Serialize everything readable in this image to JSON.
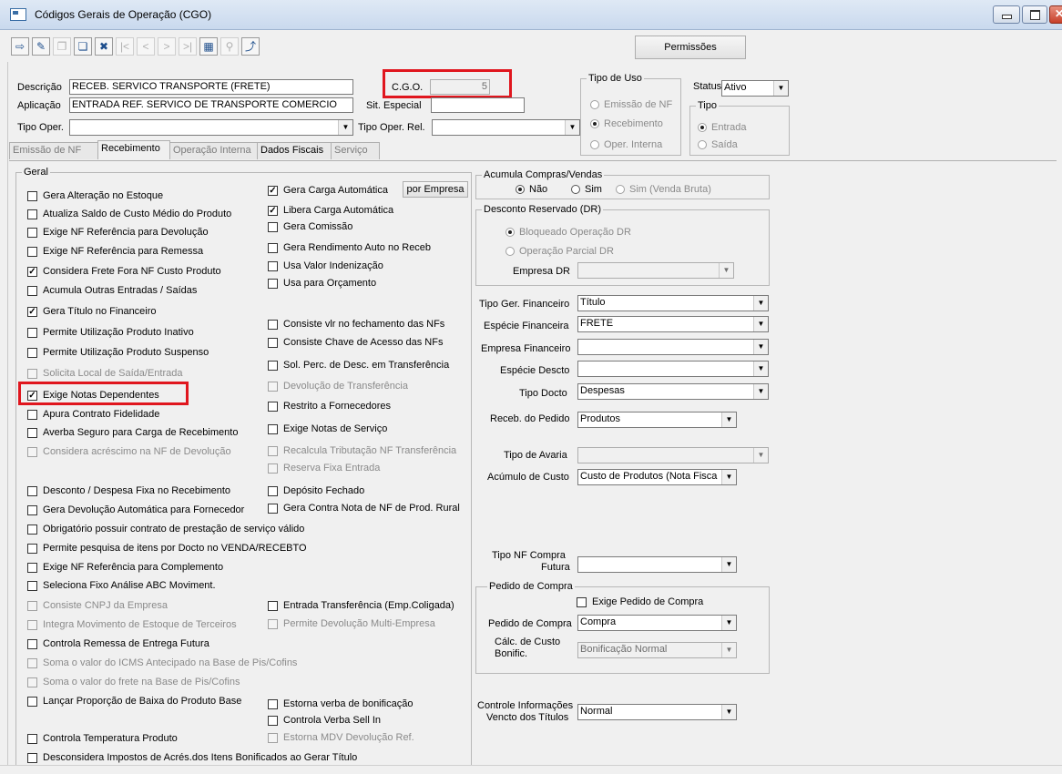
{
  "window": {
    "title": "Códigos Gerais de Operação (CGO)"
  },
  "toolbar": {
    "permissoes_label": "Permissões"
  },
  "header": {
    "descricao_label": "Descrição",
    "descricao_value": "RECEB. SERVICO TRANSPORTE (FRETE)",
    "aplicacao_label": "Aplicação",
    "aplicacao_value": "ENTRADA REF. SERVICO DE TRANSPORTE COMERCIO",
    "cgo_label": "C.G.O.",
    "cgo_value": "5",
    "sit_especial_label": "Sit. Especial",
    "sit_especial_value": "",
    "tipo_oper_label": "Tipo Oper.",
    "tipo_oper_value": "",
    "tipo_oper_rel_label": "Tipo Oper. Rel.",
    "tipo_oper_rel_value": "",
    "tipo_uso_label": "Tipo de Uso",
    "tipo_uso_options": [
      "Emissão de NF",
      "Recebimento",
      "Oper. Interna"
    ],
    "status_label": "Status",
    "status_value": "Ativo",
    "tipo_label": "Tipo",
    "tipo_options": [
      "Entrada",
      "Saída"
    ]
  },
  "tabs": [
    "Emissão de NF",
    "Recebimento",
    "Operação Interna",
    "Dados Fiscais",
    "Serviço"
  ],
  "geral": {
    "label": "Geral",
    "col1": [
      "Gera Alteração no Estoque",
      "Atualiza Saldo de Custo Médio do Produto",
      "Exige NF Referência para Devolução",
      "Exige NF Referência para Remessa",
      "Considera Frete Fora NF Custo Produto",
      "Acumula Outras Entradas / Saídas",
      "Gera Título no Financeiro",
      "Permite Utilização Produto Inativo",
      "Permite Utilização Produto Suspenso",
      "Solicita Local de Saída/Entrada",
      "Exige Notas Dependentes",
      "Apura Contrato Fidelidade",
      "Averba Seguro para Carga de Recebimento",
      "Considera acréscimo na NF de Devolução",
      "Desconto / Despesa Fixa no Recebimento",
      "Gera Devolução Automática para Fornecedor",
      "Obrigatório possuir contrato de prestação de serviço válido",
      "Permite pesquisa de itens por Docto no VENDA/RECEBTO",
      "Exige NF Referência para Complemento",
      "Seleciona Fixo Análise ABC Moviment.",
      "Consiste CNPJ da Empresa",
      "Integra Movimento de Estoque de Terceiros",
      "Controla Remessa de Entrega Futura",
      "Soma o valor do ICMS Antecipado na Base de Pis/Cofins",
      "Soma o valor do frete na Base de Pis/Cofins",
      "Lançar Proporção de Baixa do Produto Base",
      "Controla Temperatura Produto",
      "Desconsidera Impostos de Acrés.dos Itens Bonificados ao Gerar Título"
    ],
    "col2": [
      "Gera Carga Automática",
      "Libera Carga Automática",
      "Gera Comissão",
      "Gera Rendimento Auto no Receb",
      "Usa Valor Indenização",
      "Usa para Orçamento",
      "Consiste vlr no fechamento das NFs",
      "Consiste Chave de Acesso das NFs",
      "Sol. Perc. de Desc. em Transferência",
      "Devolução de Transferência",
      "Restrito a Fornecedores",
      "Exige Notas de Serviço",
      "Recalcula Tributação NF Transferência",
      "Reserva Fixa Entrada",
      "Depósito Fechado",
      "Gera Contra Nota de NF de Prod. Rural",
      "Entrada Transferência (Emp.Coligada)",
      "Permite Devolução Multi-Empresa",
      "Estorna verba de bonificação",
      "Controla Verba Sell In",
      "Estorna MDV Devolução Ref."
    ],
    "por_empresa_label": "por Empresa"
  },
  "acumula": {
    "label": "Acumula Compras/Vendas",
    "options": [
      "Não",
      "Sim",
      "Sim (Venda Bruta)"
    ]
  },
  "desconto_dr": {
    "label": "Desconto Reservado (DR)",
    "options": [
      "Bloqueado Operação DR",
      "Operação Parcial DR"
    ],
    "empresa_label": "Empresa DR",
    "empresa_value": ""
  },
  "right": {
    "tipo_ger_fin_label": "Tipo Ger. Financeiro",
    "tipo_ger_fin_value": "Título",
    "especie_fin_label": "Espécie Financeira",
    "especie_fin_value": "FRETE",
    "empresa_fin_label": "Empresa Financeiro",
    "empresa_fin_value": "",
    "especie_desc_label": "Espécie Descto",
    "especie_desc_value": "",
    "tipo_docto_label": "Tipo Docto",
    "tipo_docto_value": "Despesas",
    "receb_pedido_label": "Receb. do Pedido",
    "receb_pedido_value": "Produtos",
    "tipo_avaria_label": "Tipo de Avaria",
    "tipo_avaria_value": "",
    "acumulo_custo_label": "Acúmulo de Custo",
    "acumulo_custo_value": "Custo de Produtos (Nota Fisca",
    "tipo_nf_label1": "Tipo NF Compra",
    "tipo_nf_label2": "Futura",
    "tipo_nf_value": "",
    "pedido_group_label": "Pedido de Compra",
    "exige_pedido_label": "Exige Pedido de Compra",
    "pedido_label": "Pedido de Compra",
    "pedido_value": "Compra",
    "calc_custo_label1": "Cálc. de Custo",
    "calc_custo_label2": "Bonific.",
    "calc_custo_value": "Bonificação Normal",
    "controle_label1": "Controle Informações",
    "controle_label2": "Vencto dos Títulos",
    "controle_value": "Normal"
  }
}
